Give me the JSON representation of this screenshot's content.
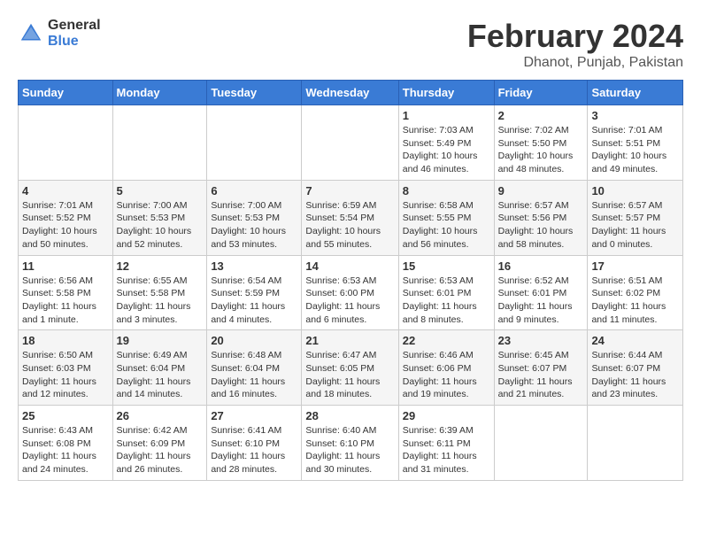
{
  "header": {
    "logo_general": "General",
    "logo_blue": "Blue",
    "title": "February 2024",
    "subtitle": "Dhanot, Punjab, Pakistan"
  },
  "calendar": {
    "days_of_week": [
      "Sunday",
      "Monday",
      "Tuesday",
      "Wednesday",
      "Thursday",
      "Friday",
      "Saturday"
    ],
    "weeks": [
      [
        {
          "day": "",
          "info": ""
        },
        {
          "day": "",
          "info": ""
        },
        {
          "day": "",
          "info": ""
        },
        {
          "day": "",
          "info": ""
        },
        {
          "day": "1",
          "sunrise": "7:03 AM",
          "sunset": "5:49 PM",
          "daylight": "10 hours and 46 minutes."
        },
        {
          "day": "2",
          "sunrise": "7:02 AM",
          "sunset": "5:50 PM",
          "daylight": "10 hours and 48 minutes."
        },
        {
          "day": "3",
          "sunrise": "7:01 AM",
          "sunset": "5:51 PM",
          "daylight": "10 hours and 49 minutes."
        }
      ],
      [
        {
          "day": "4",
          "sunrise": "7:01 AM",
          "sunset": "5:52 PM",
          "daylight": "10 hours and 50 minutes."
        },
        {
          "day": "5",
          "sunrise": "7:00 AM",
          "sunset": "5:53 PM",
          "daylight": "10 hours and 52 minutes."
        },
        {
          "day": "6",
          "sunrise": "7:00 AM",
          "sunset": "5:53 PM",
          "daylight": "10 hours and 53 minutes."
        },
        {
          "day": "7",
          "sunrise": "6:59 AM",
          "sunset": "5:54 PM",
          "daylight": "10 hours and 55 minutes."
        },
        {
          "day": "8",
          "sunrise": "6:58 AM",
          "sunset": "5:55 PM",
          "daylight": "10 hours and 56 minutes."
        },
        {
          "day": "9",
          "sunrise": "6:57 AM",
          "sunset": "5:56 PM",
          "daylight": "10 hours and 58 minutes."
        },
        {
          "day": "10",
          "sunrise": "6:57 AM",
          "sunset": "5:57 PM",
          "daylight": "11 hours and 0 minutes."
        }
      ],
      [
        {
          "day": "11",
          "sunrise": "6:56 AM",
          "sunset": "5:58 PM",
          "daylight": "11 hours and 1 minute."
        },
        {
          "day": "12",
          "sunrise": "6:55 AM",
          "sunset": "5:58 PM",
          "daylight": "11 hours and 3 minutes."
        },
        {
          "day": "13",
          "sunrise": "6:54 AM",
          "sunset": "5:59 PM",
          "daylight": "11 hours and 4 minutes."
        },
        {
          "day": "14",
          "sunrise": "6:53 AM",
          "sunset": "6:00 PM",
          "daylight": "11 hours and 6 minutes."
        },
        {
          "day": "15",
          "sunrise": "6:53 AM",
          "sunset": "6:01 PM",
          "daylight": "11 hours and 8 minutes."
        },
        {
          "day": "16",
          "sunrise": "6:52 AM",
          "sunset": "6:01 PM",
          "daylight": "11 hours and 9 minutes."
        },
        {
          "day": "17",
          "sunrise": "6:51 AM",
          "sunset": "6:02 PM",
          "daylight": "11 hours and 11 minutes."
        }
      ],
      [
        {
          "day": "18",
          "sunrise": "6:50 AM",
          "sunset": "6:03 PM",
          "daylight": "11 hours and 12 minutes."
        },
        {
          "day": "19",
          "sunrise": "6:49 AM",
          "sunset": "6:04 PM",
          "daylight": "11 hours and 14 minutes."
        },
        {
          "day": "20",
          "sunrise": "6:48 AM",
          "sunset": "6:04 PM",
          "daylight": "11 hours and 16 minutes."
        },
        {
          "day": "21",
          "sunrise": "6:47 AM",
          "sunset": "6:05 PM",
          "daylight": "11 hours and 18 minutes."
        },
        {
          "day": "22",
          "sunrise": "6:46 AM",
          "sunset": "6:06 PM",
          "daylight": "11 hours and 19 minutes."
        },
        {
          "day": "23",
          "sunrise": "6:45 AM",
          "sunset": "6:07 PM",
          "daylight": "11 hours and 21 minutes."
        },
        {
          "day": "24",
          "sunrise": "6:44 AM",
          "sunset": "6:07 PM",
          "daylight": "11 hours and 23 minutes."
        }
      ],
      [
        {
          "day": "25",
          "sunrise": "6:43 AM",
          "sunset": "6:08 PM",
          "daylight": "11 hours and 24 minutes."
        },
        {
          "day": "26",
          "sunrise": "6:42 AM",
          "sunset": "6:09 PM",
          "daylight": "11 hours and 26 minutes."
        },
        {
          "day": "27",
          "sunrise": "6:41 AM",
          "sunset": "6:10 PM",
          "daylight": "11 hours and 28 minutes."
        },
        {
          "day": "28",
          "sunrise": "6:40 AM",
          "sunset": "6:10 PM",
          "daylight": "11 hours and 30 minutes."
        },
        {
          "day": "29",
          "sunrise": "6:39 AM",
          "sunset": "6:11 PM",
          "daylight": "11 hours and 31 minutes."
        },
        {
          "day": "",
          "info": ""
        },
        {
          "day": "",
          "info": ""
        }
      ]
    ]
  }
}
